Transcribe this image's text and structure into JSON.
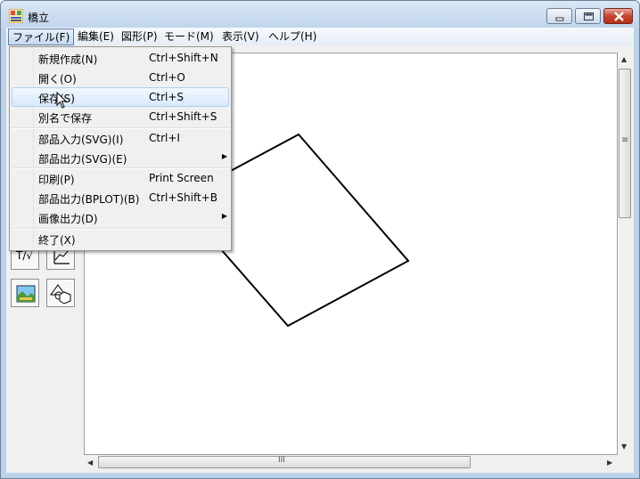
{
  "window": {
    "title": "橋立",
    "icon": "app-logo-icon"
  },
  "window_controls": [
    "minimize-icon",
    "maximize-icon",
    "close-icon"
  ],
  "menubar": {
    "items": [
      {
        "label": "ファイル(F)",
        "open": true
      },
      {
        "label": "編集(E)"
      },
      {
        "label": "図形(P)"
      },
      {
        "label": "モード(M)"
      },
      {
        "label": "表示(V)"
      },
      {
        "label": "ヘルプ(H)"
      }
    ]
  },
  "file_menu": {
    "items": [
      {
        "label": "新規作成(N)",
        "shortcut": "Ctrl+Shift+N"
      },
      {
        "label": "開く(O)",
        "shortcut": "Ctrl+O"
      },
      {
        "label": "保存(S)",
        "shortcut": "Ctrl+S",
        "highlighted": true
      },
      {
        "label": "別名で保存",
        "shortcut": "Ctrl+Shift+S"
      },
      {
        "label": "部品入力(SVG)(I)",
        "shortcut": "Ctrl+I"
      },
      {
        "label": "部品出力(SVG)(E)",
        "submenu": true
      },
      {
        "label": "印刷(P)",
        "shortcut": "Print Screen"
      },
      {
        "label": "部品出力(BPLOT)(B)",
        "shortcut": "Ctrl+Shift+B"
      },
      {
        "label": "画像出力(D)",
        "submenu": true
      },
      {
        "label": "終了(X)"
      }
    ]
  },
  "toolbox": {
    "visible_tools": [
      {
        "name": "text-formula-tool",
        "label": "T/√"
      },
      {
        "name": "graph-tool-icon"
      },
      {
        "name": "image-tool-icon"
      },
      {
        "name": "shapes-tool-icon"
      }
    ]
  },
  "scrollbars": {
    "h_thumb_grip": "III",
    "v_thumb_grip": "≡"
  },
  "canvas": {
    "shape": "rotated-square",
    "stroke": "#000000",
    "background": "#ffffff"
  }
}
